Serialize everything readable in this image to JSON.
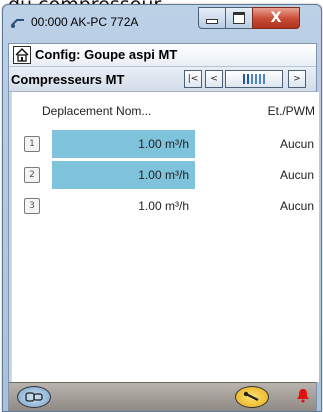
{
  "background_caption": "du compresseur",
  "window": {
    "title": "00:000 AK-PC 772A",
    "close_glyph": "X"
  },
  "header": {
    "title": "Config: Goupe aspi MT"
  },
  "section": {
    "title": "Compresseurs MT",
    "nav_first": "|<",
    "nav_prev": "<",
    "nav_next": ">"
  },
  "table": {
    "columns": [
      "Deplacement Nom...",
      "Et./PWM"
    ],
    "rows": [
      {
        "index": "1",
        "displacement": "1.00 m³/h",
        "pwm": "Aucun",
        "selected": true
      },
      {
        "index": "2",
        "displacement": "1.00 m³/h",
        "pwm": "Aucun",
        "selected": true
      },
      {
        "index": "3",
        "displacement": "1.00 m³/h",
        "pwm": "Aucun",
        "selected": false
      }
    ]
  },
  "footer": {
    "left_icon": "compressor-icon",
    "mid_icon": "wrench-icon",
    "right_icon": "alarm-bell-icon"
  },
  "colors": {
    "selection": "#7fc2dc",
    "close_button": "#c74a33",
    "alarm": "#e01010"
  }
}
